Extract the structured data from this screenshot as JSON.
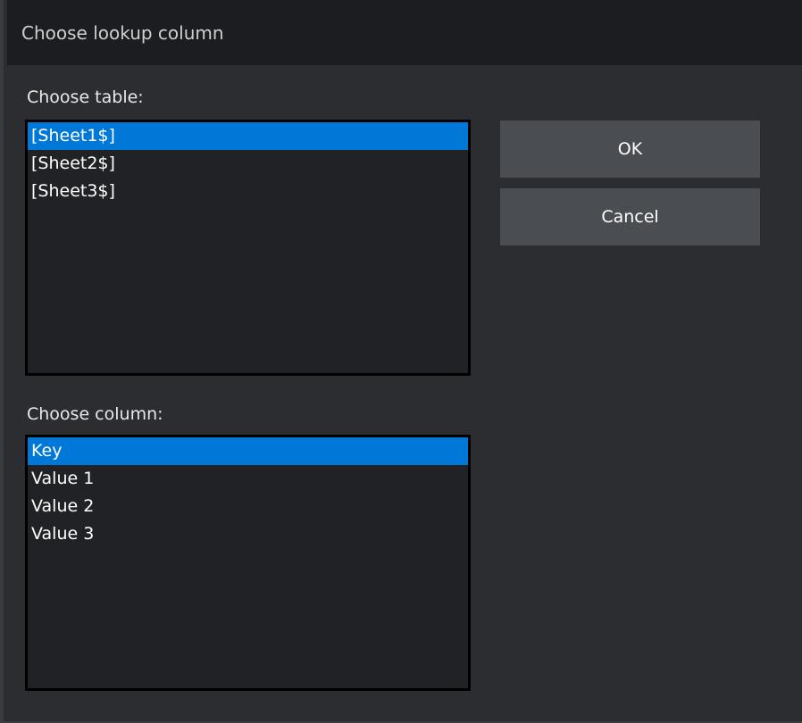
{
  "window": {
    "title": "Choose lookup column"
  },
  "table_section": {
    "label": "Choose table:",
    "items": [
      "[Sheet1$]",
      "[Sheet2$]",
      "[Sheet3$]"
    ],
    "selected": "[Sheet1$]"
  },
  "column_section": {
    "label": "Choose column:",
    "items": [
      "Key",
      "Value 1",
      "Value 2",
      "Value 3"
    ],
    "selected": "Key"
  },
  "buttons": {
    "ok_label": "OK",
    "cancel_label": "Cancel"
  },
  "colors": {
    "background": "#2b2d31",
    "titlebar": "#1c1d20",
    "list_background": "#202226",
    "selection": "#0078d7",
    "button": "#4a4d52"
  }
}
